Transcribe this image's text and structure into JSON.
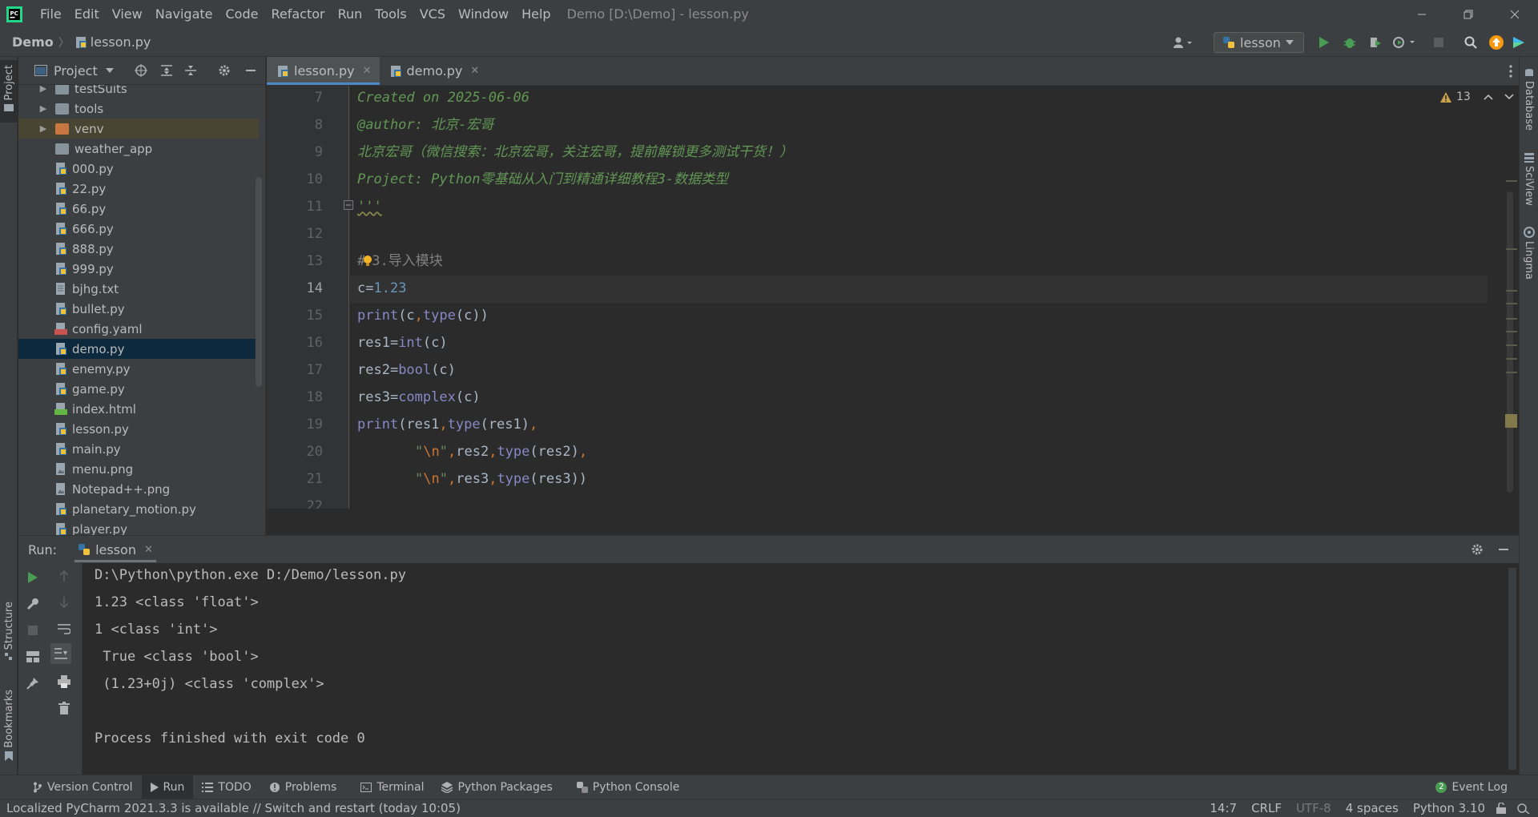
{
  "menubar": {
    "items": [
      "File",
      "Edit",
      "View",
      "Navigate",
      "Code",
      "Refactor",
      "Run",
      "Tools",
      "VCS",
      "Window",
      "Help"
    ],
    "window_title": "Demo [D:\\Demo] - lesson.py"
  },
  "navbar": {
    "project": "Demo",
    "file": "lesson.py",
    "run_config": "lesson"
  },
  "left_stripe": {
    "project": "Project",
    "structure": "Structure",
    "bookmarks": "Bookmarks"
  },
  "right_stripe": {
    "database": "Database",
    "sciview": "SciView",
    "lingma": "Lingma"
  },
  "project_panel": {
    "title": "Project",
    "items": [
      {
        "name": "testSuits",
        "type": "folder"
      },
      {
        "name": "tools",
        "type": "folder"
      },
      {
        "name": "venv",
        "type": "folder"
      },
      {
        "name": "weather_app",
        "type": "folder"
      },
      {
        "name": "000.py",
        "type": "py"
      },
      {
        "name": "22.py",
        "type": "py"
      },
      {
        "name": "66.py",
        "type": "py"
      },
      {
        "name": "666.py",
        "type": "py"
      },
      {
        "name": "888.py",
        "type": "py"
      },
      {
        "name": "999.py",
        "type": "py"
      },
      {
        "name": "bjhg.txt",
        "type": "txt"
      },
      {
        "name": "bullet.py",
        "type": "py"
      },
      {
        "name": "config.yaml",
        "type": "yaml"
      },
      {
        "name": "demo.py",
        "type": "py"
      },
      {
        "name": "enemy.py",
        "type": "py"
      },
      {
        "name": "game.py",
        "type": "py"
      },
      {
        "name": "index.html",
        "type": "html"
      },
      {
        "name": "lesson.py",
        "type": "py"
      },
      {
        "name": "main.py",
        "type": "py"
      },
      {
        "name": "menu.png",
        "type": "png"
      },
      {
        "name": "Notepad++.png",
        "type": "png"
      },
      {
        "name": "planetary_motion.py",
        "type": "py"
      },
      {
        "name": "player.py",
        "type": "py"
      }
    ],
    "yaml_badge": "YML",
    "html_badge": "HT"
  },
  "editor": {
    "tabs": [
      {
        "label": "lesson.py",
        "active": true
      },
      {
        "label": "demo.py",
        "active": false
      }
    ],
    "warnings_count": "13",
    "line_numbers": [
      "7",
      "8",
      "9",
      "10",
      "11",
      "12",
      "13",
      "14",
      "15",
      "16",
      "17",
      "18",
      "19",
      "20",
      "21",
      "22"
    ],
    "code": {
      "l7": "Created on 2025-06-06",
      "l8": "@author: 北京-宏哥",
      "l9": "北京宏哥（微信搜索：北京宏哥，关注宏哥，提前解锁更多测试干货！）",
      "l10": "Project: Python零基础从入门到精通详细教程3-数据类型",
      "l11": "'''",
      "l13a": "#",
      "l13b": "3.导入模块",
      "l14a": "c=",
      "l14b": "1.23",
      "l15a": "print",
      "l15b": "(c",
      "l15c": ",",
      "l15d": "type",
      "l15e": "(c))",
      "l16a": "res1=",
      "l16b": "int",
      "l16c": "(c)",
      "l17a": "res2=",
      "l17b": "bool",
      "l17c": "(c)",
      "l18a": "res3=",
      "l18b": "complex",
      "l18c": "(c)",
      "l19a": "print",
      "l19b": "(res1",
      "l19c": ",",
      "l19d": "type",
      "l19e": "(res1)",
      "l19f": ",",
      "l20a": "\"",
      "l20b": "\\n",
      "l20c": "\"",
      "l20d": ",",
      "l20e": "res2",
      "l20f": ",",
      "l20g": "type",
      "l20h": "(res2)",
      "l20i": ",",
      "l21a": "\"",
      "l21b": "\\n",
      "l21c": "\"",
      "l21d": ",",
      "l21e": "res3",
      "l21f": ",",
      "l21g": "type",
      "l21h": "(res3))"
    }
  },
  "run_panel": {
    "label": "Run:",
    "tab": "lesson",
    "output": [
      "D:\\Python\\python.exe D:/Demo/lesson.py",
      "1.23 <class 'float'>",
      "1 <class 'int'>",
      " True <class 'bool'>",
      " (1.23+0j) <class 'complex'>",
      "",
      "Process finished with exit code 0"
    ]
  },
  "tool_tabs": [
    {
      "label": "Version Control",
      "icon": "branch-icon"
    },
    {
      "label": "Run",
      "icon": "run-icon"
    },
    {
      "label": "TODO",
      "icon": "list-icon"
    },
    {
      "label": "Problems",
      "icon": "info-icon"
    },
    {
      "label": "Terminal",
      "icon": "terminal-icon"
    },
    {
      "label": "Python Packages",
      "icon": "layers-icon"
    },
    {
      "label": "Python Console",
      "icon": "python-icon"
    }
  ],
  "event_log": {
    "label": "Event Log",
    "count": "2"
  },
  "statusbar": {
    "message": "Localized PyCharm 2021.3.3 is available // Switch and restart (today 10:05)",
    "position": "14:7",
    "line_sep": "CRLF",
    "encoding": "UTF-8",
    "indent": "4 spaces",
    "interpreter": "Python 3.10"
  },
  "colors": {
    "background": "#2b2b2b",
    "panel": "#3c3f41",
    "docstring": "#629755",
    "number": "#6897bb",
    "builtin": "#8888c6",
    "keyword": "#cc7832",
    "selection": "#0d293e",
    "run_green": "#499c54"
  }
}
